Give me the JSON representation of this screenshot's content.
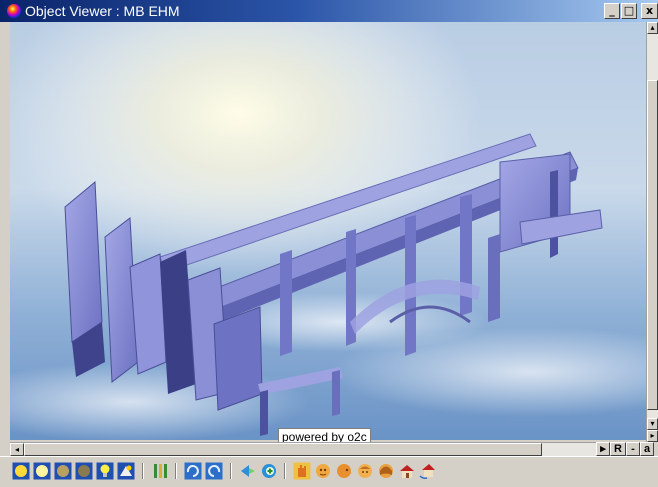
{
  "window": {
    "title": "Object Viewer : MB EHM",
    "minimize_label": "_",
    "maximize_label": "□",
    "close_label": "x"
  },
  "viewer": {
    "watermark": "powered by o2c",
    "sky_top_color": "#c7d8ea",
    "model_color": "#8a8fd6"
  },
  "scrollbars": {
    "corner_labels": [
      "▸",
      "R",
      "-",
      "a"
    ]
  },
  "toolbar": {
    "groups": [
      [
        "render-shaded-icon",
        "render-smooth-icon",
        "render-solid-icon",
        "render-flat-icon",
        "light-icon",
        "texture-icon"
      ],
      [
        "stripes-icon"
      ],
      [
        "rotate-icon",
        "rotate-reverse-icon"
      ],
      [
        "zoom-icon",
        "zoom-in-icon"
      ],
      [
        "hand-pan-icon",
        "head-front-icon",
        "head-side-icon",
        "head-top-icon",
        "head-back-icon",
        "house-icon",
        "house-rotate-icon"
      ]
    ]
  }
}
